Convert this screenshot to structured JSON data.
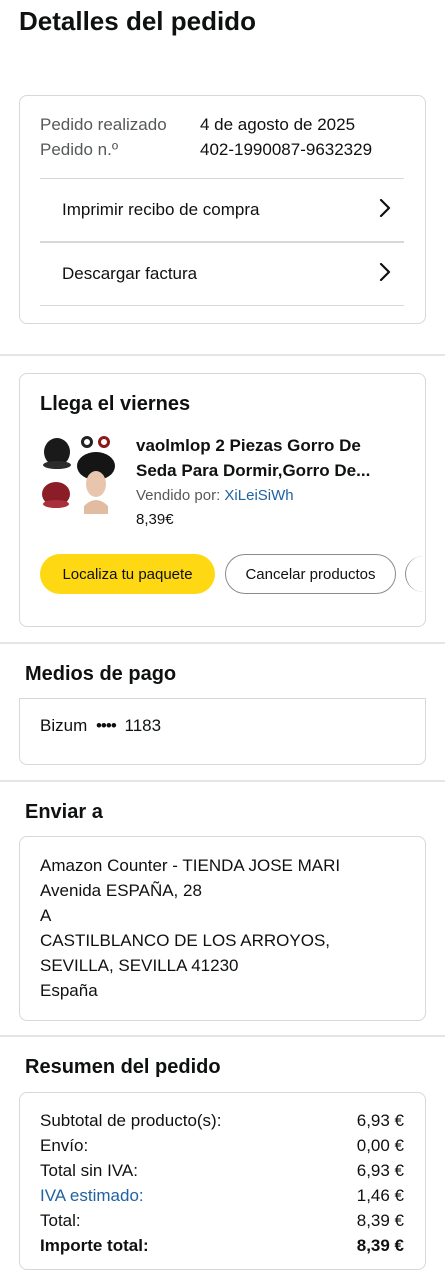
{
  "page": {
    "title": "Detalles del pedido"
  },
  "order_info": {
    "placed_label": "Pedido realizado",
    "placed_value": "4 de agosto de 2025",
    "number_label": "Pedido n.º",
    "number_value": "402-1990087-9632329",
    "print_receipt": "Imprimir recibo de compra",
    "download_invoice": "Descargar factura"
  },
  "shipment": {
    "arrival": "Llega el viernes",
    "product_title_line1": "vaolmlop 2 Piezas Gorro De",
    "product_title_line2": "Seda Para Dormir,Gorro De...",
    "sold_by_label": "Vendido por:",
    "seller": "XiLeiSiWh",
    "price": "8,39€",
    "track_button": "Localiza tu paquete",
    "cancel_button": "Cancelar productos"
  },
  "payment": {
    "title": "Medios de pago",
    "method": "Bizum",
    "mask": "••••",
    "last_digits": "1183"
  },
  "shipping": {
    "title": "Enviar a",
    "lines": [
      "Amazon Counter - TIENDA JOSE MARI",
      "Avenida ESPAÑA, 28",
      "A",
      "CASTILBLANCO DE LOS ARROYOS,",
      "SEVILLA, SEVILLA 41230",
      "España"
    ]
  },
  "summary": {
    "title": "Resumen del pedido",
    "rows": [
      {
        "label": "Subtotal de producto(s):",
        "value": "6,93 €"
      },
      {
        "label": "Envío:",
        "value": "0,00 €"
      },
      {
        "label": "Total sin IVA:",
        "value": "6,93 €"
      },
      {
        "label": "IVA estimado:",
        "value": "1,46 €"
      },
      {
        "label": "Total:",
        "value": "8,39 €"
      },
      {
        "label": "Importe total:",
        "value": "8,39 €"
      }
    ]
  },
  "colors": {
    "accent_yellow": "#ffd814",
    "link_blue": "#2162a1",
    "border": "#d5d9d9",
    "text": "#0f1111",
    "secondary_text": "#565959"
  },
  "icons": {
    "row_chevron": "chevron-right-icon",
    "product_image": "product-thumbnail"
  }
}
